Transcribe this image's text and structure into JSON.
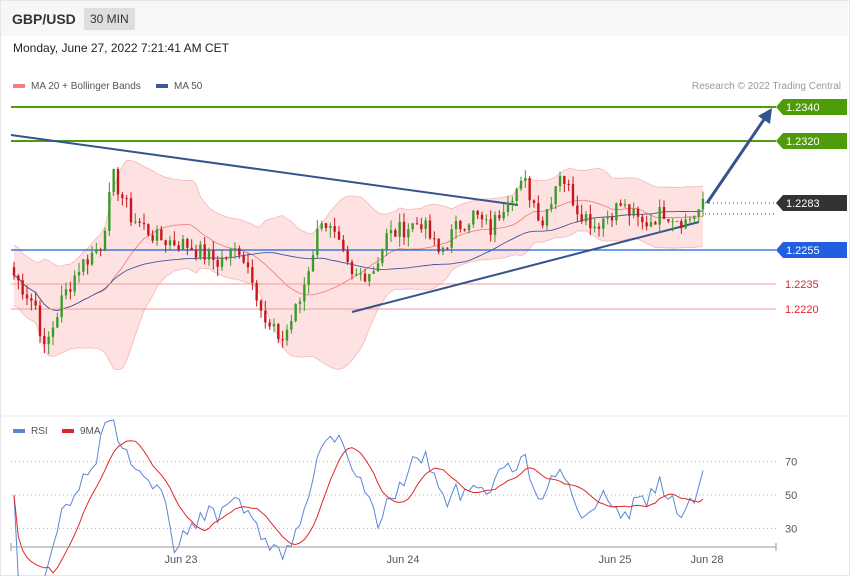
{
  "header": {
    "symbol": "GBP/USD",
    "timeframe": "30 MIN"
  },
  "timestamp": "Monday, June 27, 2022 7:21:41 AM CET",
  "credit": "Research © 2022 Trading Central",
  "colors": {
    "bull": "#3a9a2a",
    "bear": "#c8161d",
    "bands": "#fdd6d6",
    "ma20": "#f08080",
    "ma50": "#3b5998",
    "green": "#4e9c0a",
    "blue": "#1f5fe0",
    "red": "#e0262c",
    "dark": "#333333",
    "trend": "#34558b"
  },
  "chart_data": [
    {
      "type": "candlestick",
      "legend": [
        {
          "name": "MA 20 + Bollinger Bands",
          "color": "#f08080"
        },
        {
          "name": "MA 50",
          "color": "#3b5998"
        }
      ],
      "levels": [
        {
          "value": "1.2340",
          "color": "#4e9c0a"
        },
        {
          "value": "1.2320",
          "color": "#4e9c0a"
        },
        {
          "value": "1.2283",
          "color": "#333333"
        },
        {
          "value": "1.2255",
          "color": "#1f5fe0"
        },
        {
          "value": "1.2235",
          "color": "#e0262c"
        },
        {
          "value": "1.2220",
          "color": "#e0262c"
        }
      ],
      "x_labels": [
        "Jun 23",
        "Jun 24",
        "Jun 25",
        "Jun 28"
      ],
      "last_price": 1.2283
    },
    {
      "type": "line",
      "legend": [
        {
          "name": "RSI",
          "color": "#5b86d6"
        },
        {
          "name": "9MA",
          "color": "#e0262c"
        }
      ],
      "y_ticks": [
        "70",
        "50",
        "30"
      ],
      "ylim": [
        20,
        80
      ]
    }
  ]
}
